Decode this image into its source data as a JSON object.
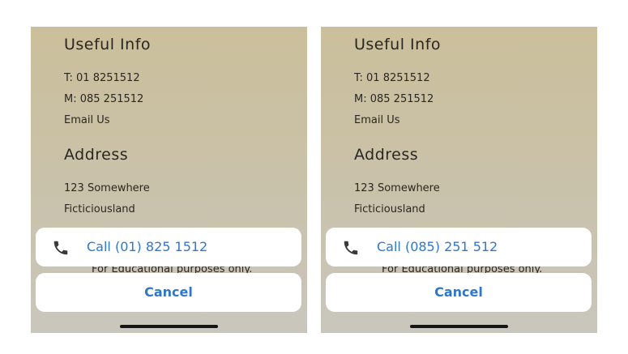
{
  "screens": [
    {
      "useful_info_heading": "Useful Info",
      "telephone": "T: 01 8251512",
      "mobile": "M: 085 251512",
      "email_link": "Email Us",
      "address_heading": "Address",
      "address_line1": "123 Somewhere",
      "address_line2": "Ficticiousland",
      "footer_text": "For Educational purposes only.",
      "call_action_label": "Call (01) 825 1512",
      "cancel_label": "Cancel",
      "icon": "phone-icon"
    },
    {
      "useful_info_heading": "Useful Info",
      "telephone": "T: 01 8251512",
      "mobile": "M: 085 251512",
      "email_link": "Email Us",
      "address_heading": "Address",
      "address_line1": "123 Somewhere",
      "address_line2": "Ficticiousland",
      "footer_text": "For Educational purposes only.",
      "call_action_label": "Call (085) 251 512",
      "cancel_label": "Cancel",
      "icon": "phone-icon"
    }
  ],
  "colors": {
    "action_text": "#2f77c8",
    "sheet_background": "#ffffff",
    "screen_background_top": "#cbbf9b",
    "screen_background_bottom": "#c9c6bd"
  }
}
